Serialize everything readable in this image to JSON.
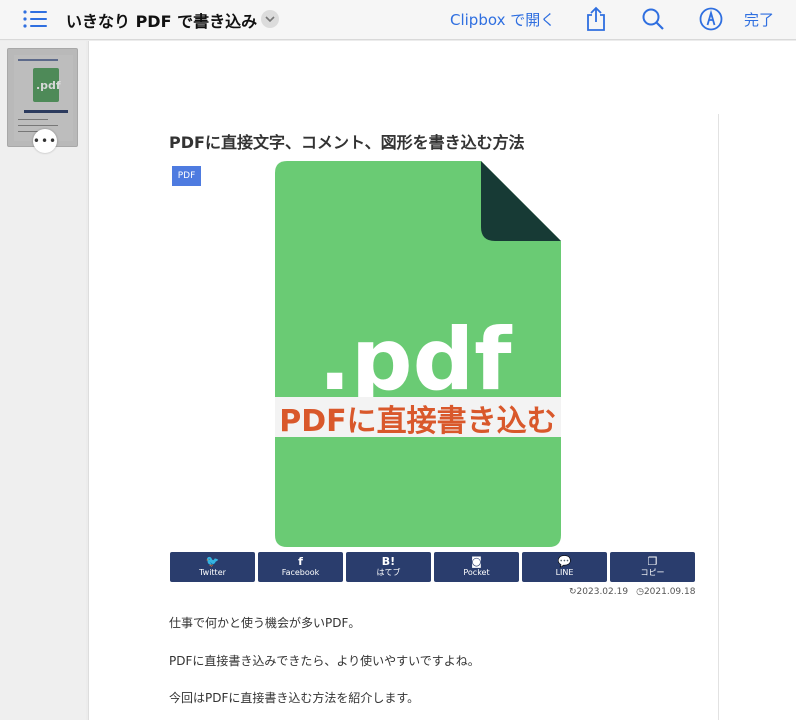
{
  "toolbar": {
    "title": "いきなり PDF で書き込み",
    "open_in_label": "Clipbox で開く",
    "done_label": "完了"
  },
  "sidebar": {
    "thumbnail_text": ".pdf",
    "more_label": "•••"
  },
  "article": {
    "title": "PDFに直接文字、コメント、図形を書き込む方法",
    "tag": "PDF",
    "hero": {
      "ext_text": ".pdf",
      "banner_text": "PDFに直接書き込む"
    },
    "share_buttons": [
      {
        "glyph": "🐦",
        "label": "Twitter"
      },
      {
        "glyph": "f",
        "label": "Facebook"
      },
      {
        "glyph": "B!",
        "label": "はてブ"
      },
      {
        "glyph": "◙",
        "label": "Pocket"
      },
      {
        "glyph": "💬",
        "label": "LINE"
      },
      {
        "glyph": "❐",
        "label": "コピー"
      }
    ],
    "updated_date": "2023.02.19",
    "published_date": "2021.09.18",
    "paragraphs": [
      "仕事で何かと使う機会が多いPDF。",
      "PDFに直接書き込みできたら、より使いやすいですよね。",
      "今回はPDFに直接書き込む方法を紹介します。"
    ]
  },
  "colors": {
    "accent": "#2f6fe0",
    "share_button_bg": "#2a3d6d",
    "hero_green": "#6acb74",
    "hero_corner": "#173a35",
    "banner_text": "#d9582b",
    "tag_bg": "#4e7be0"
  },
  "icons": {
    "list": "list-icon",
    "chevron": "chevron-down-icon",
    "share": "share-icon",
    "search": "search-icon",
    "markup": "markup-pen-icon"
  }
}
